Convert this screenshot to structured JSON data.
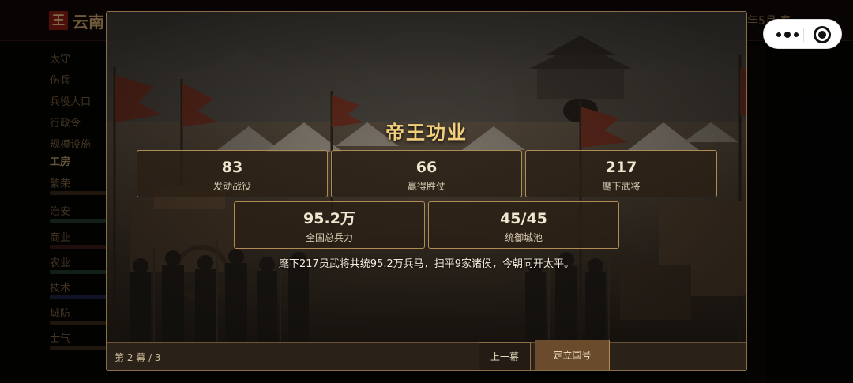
{
  "app": {
    "logo_char": "王",
    "title_partial": "云南",
    "date_partial": "年5月·春",
    "sidebar": {
      "labels": [
        "太守",
        "伤兵",
        "兵役人口",
        "行政令",
        "规模设施",
        "工房"
      ],
      "stats": [
        "繁荣",
        "治安",
        "商业",
        "农业",
        "技术",
        "城防",
        "士气"
      ]
    }
  },
  "capsule": {
    "menu_icon": "more-dots-icon",
    "close_icon": "record-circle-icon"
  },
  "modal": {
    "title": "帝王功业",
    "stats": [
      {
        "value": "83",
        "label": "发动战役"
      },
      {
        "value": "66",
        "label": "赢得胜仗"
      },
      {
        "value": "217",
        "label": "麾下武将"
      },
      {
        "value": "95.2万",
        "label": "全国总兵力"
      },
      {
        "value": "45/45",
        "label": "统御城池"
      }
    ],
    "summary": "麾下217员武将共统95.2万兵马，扫平9家诸侯，今朝同开太平。",
    "footer": {
      "page_indicator": "第 2 幕 / 3",
      "prev_label": "上一幕",
      "next_label": "定立国号"
    }
  },
  "colors": {
    "accent_gold": "#f1cf7c",
    "border_gold": "#b08c55",
    "primary_button": "#6a4c2c"
  }
}
